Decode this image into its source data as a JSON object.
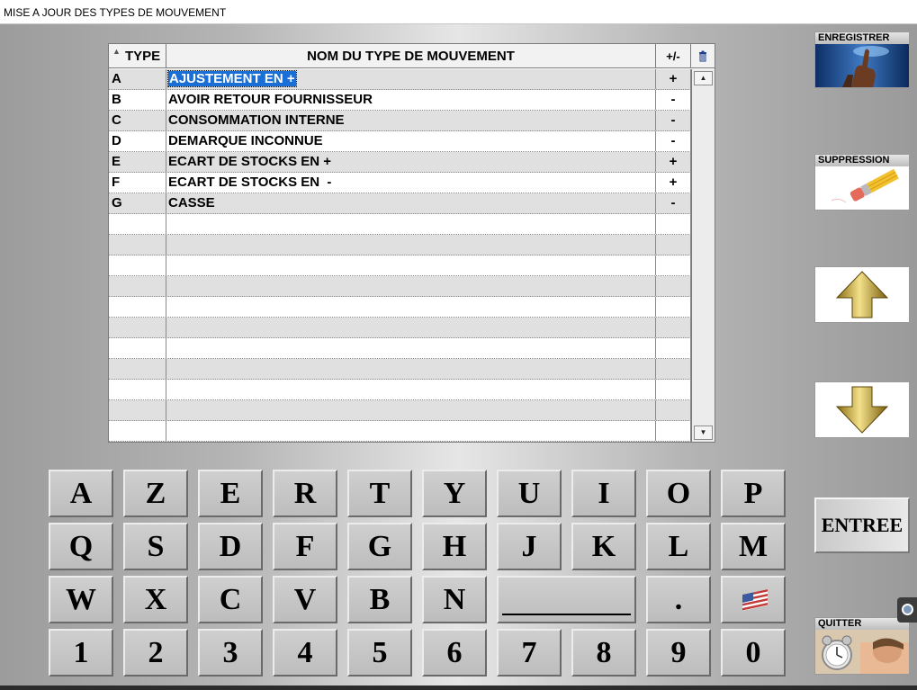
{
  "window": {
    "title": "MISE A JOUR DES TYPES DE MOUVEMENT"
  },
  "grid": {
    "headers": {
      "type": "TYPE",
      "name": "NOM DU TYPE DE MOUVEMENT",
      "sign": "+/-"
    },
    "rows": [
      {
        "type": "A",
        "name": "AJUSTEMENT EN +",
        "sign": "+"
      },
      {
        "type": "B",
        "name": "AVOIR RETOUR FOURNISSEUR",
        "sign": "-"
      },
      {
        "type": "C",
        "name": "CONSOMMATION INTERNE",
        "sign": "-"
      },
      {
        "type": "D",
        "name": "DEMARQUE INCONNUE",
        "sign": "-"
      },
      {
        "type": "E",
        "name": "ECART DE STOCKS EN +",
        "sign": "+"
      },
      {
        "type": "F",
        "name": "ECART DE STOCKS EN  -",
        "sign": "+"
      },
      {
        "type": "G",
        "name": "CASSE",
        "sign": "-"
      }
    ],
    "empty_rows": 11,
    "selected_row": 0,
    "icons": {
      "sort": "sort-asc-icon",
      "delete": "trash-icon",
      "scroll_up": "arrow-up-icon",
      "scroll_down": "arrow-down-icon"
    }
  },
  "keyboard": {
    "row1": [
      "A",
      "Z",
      "E",
      "R",
      "T",
      "Y",
      "U",
      "I",
      "O",
      "P"
    ],
    "row2": [
      "Q",
      "S",
      "D",
      "F",
      "G",
      "H",
      "J",
      "K",
      "L",
      "M"
    ],
    "row3": [
      "W",
      "X",
      "C",
      "V",
      "B",
      "N"
    ],
    "dot": ".",
    "row4": [
      "1",
      "2",
      "3",
      "4",
      "5",
      "6",
      "7",
      "8",
      "9",
      "0"
    ],
    "icons": {
      "space": "space-key",
      "flag": "us-flag-icon"
    }
  },
  "side": {
    "save_label": "ENREGISTRER",
    "delete_label": "SUPPRESSION",
    "enter_label": "ENTREE",
    "quit_label": "QUITTER",
    "icons": {
      "save": "touch-hand-icon",
      "delete": "pencil-eraser-icon",
      "up": "gold-arrow-up-icon",
      "down": "gold-arrow-down-icon",
      "quit": "alarm-clock-sleep-icon",
      "tab": "side-panel-toggle-icon"
    }
  },
  "colors": {
    "selection": "#1a6fd6",
    "gold": "#c9a833"
  }
}
